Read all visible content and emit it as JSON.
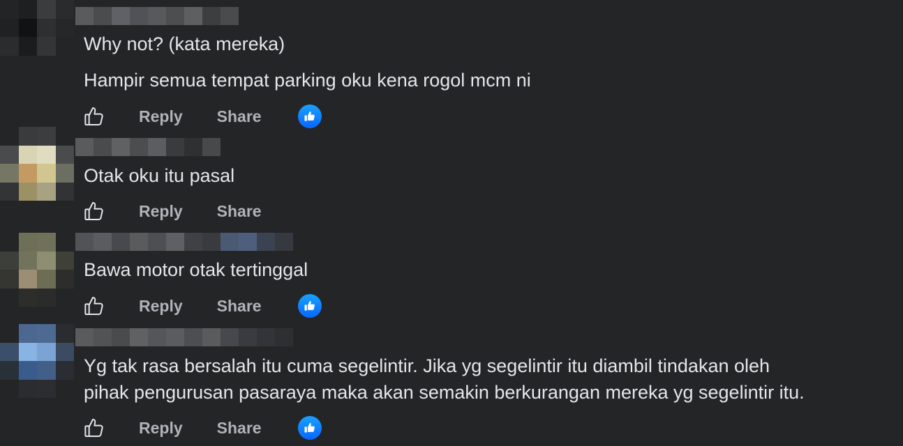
{
  "actions": {
    "reply_label": "Reply",
    "share_label": "Share"
  },
  "icons": {
    "like": "thumbs-up-outline-icon",
    "reaction": "like-reaction-icon"
  },
  "colors": {
    "background": "#242526",
    "text": "#e4e6eb",
    "action_text": "#b0b3b8",
    "reaction_blue": "#0866ff"
  },
  "comments": [
    {
      "lines": [
        "Why not? (kata mereka)",
        "Hampir semua tempat parking oku kena rogol mcm ni"
      ],
      "has_reaction": true
    },
    {
      "lines": [
        "Otak oku itu pasal"
      ],
      "has_reaction": false
    },
    {
      "lines": [
        "Bawa motor otak tertinggal"
      ],
      "has_reaction": true
    },
    {
      "lines": [
        "Yg tak rasa bersalah itu cuma segelintir. Jika yg segelintir itu diambil tindakan oleh",
        "pihak pengurusan pasaraya maka akan semakin berkurangan mereka yg segelintir itu."
      ],
      "has_reaction": true
    }
  ]
}
